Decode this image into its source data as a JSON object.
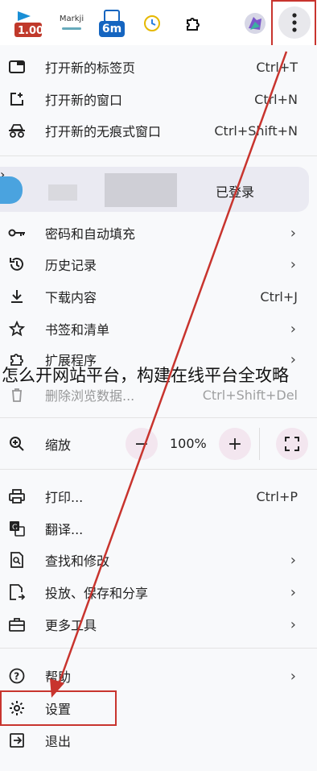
{
  "toolbar": {
    "ext_badge_1": "1.00",
    "ext_badge_2": "Markji",
    "ext_badge_3": "6m"
  },
  "menu": {
    "new_tab": {
      "label": "打开新的标签页",
      "shortcut": "Ctrl+T"
    },
    "new_window": {
      "label": "打开新的窗口",
      "shortcut": "Ctrl+N"
    },
    "incognito": {
      "label": "打开新的无痕式窗口",
      "shortcut": "Ctrl+Shift+N"
    },
    "profile": {
      "status": "已登录"
    },
    "passwords": {
      "label": "密码和自动填充"
    },
    "history": {
      "label": "历史记录"
    },
    "downloads": {
      "label": "下载内容",
      "shortcut": "Ctrl+J"
    },
    "bookmarks": {
      "label": "书签和清单"
    },
    "extensions": {
      "label": "扩展程序"
    },
    "clear_data": {
      "label": "删除浏览数据...",
      "shortcut": "Ctrl+Shift+Del"
    },
    "zoom": {
      "label": "缩放",
      "minus": "−",
      "value": "100%",
      "plus": "+"
    },
    "print": {
      "label": "打印...",
      "shortcut": "Ctrl+P"
    },
    "translate": {
      "label": "翻译..."
    },
    "find_edit": {
      "label": "查找和修改"
    },
    "cast_save_share": {
      "label": "投放、保存和分享"
    },
    "more_tools": {
      "label": "更多工具"
    },
    "help": {
      "label": "帮助"
    },
    "settings": {
      "label": "设置"
    },
    "exit": {
      "label": "退出"
    }
  },
  "overlay_title": "怎么开网站平台，构建在线平台全攻略",
  "colors": {
    "accent_red": "#c8342e",
    "menu_bg": "#f8f9fb",
    "zoom_btn_bg": "#f3e6ef"
  }
}
